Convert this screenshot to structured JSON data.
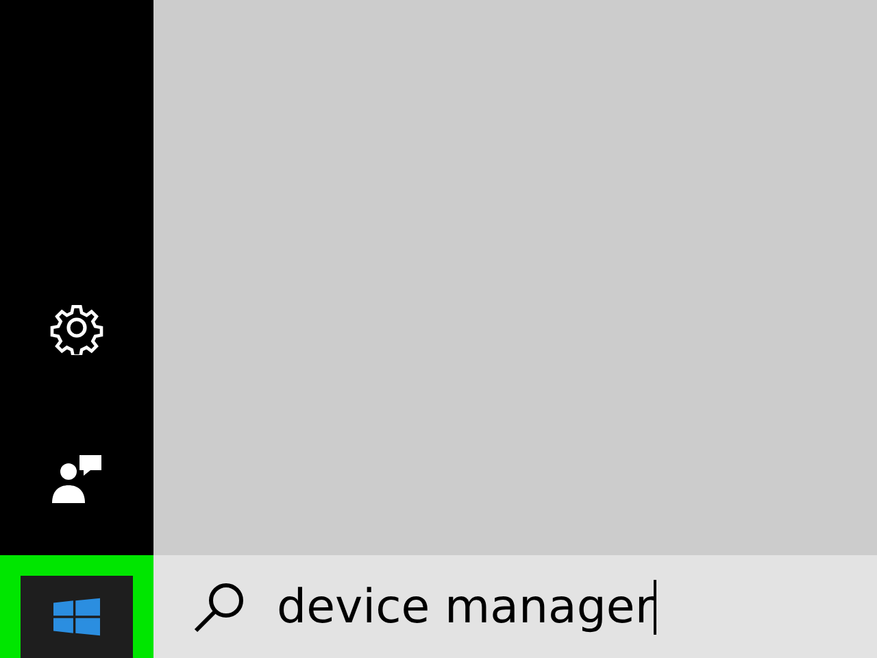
{
  "sidebar": {
    "items": [
      {
        "kind": "settings"
      },
      {
        "kind": "feedback"
      }
    ]
  },
  "search": {
    "value": "device manager"
  }
}
